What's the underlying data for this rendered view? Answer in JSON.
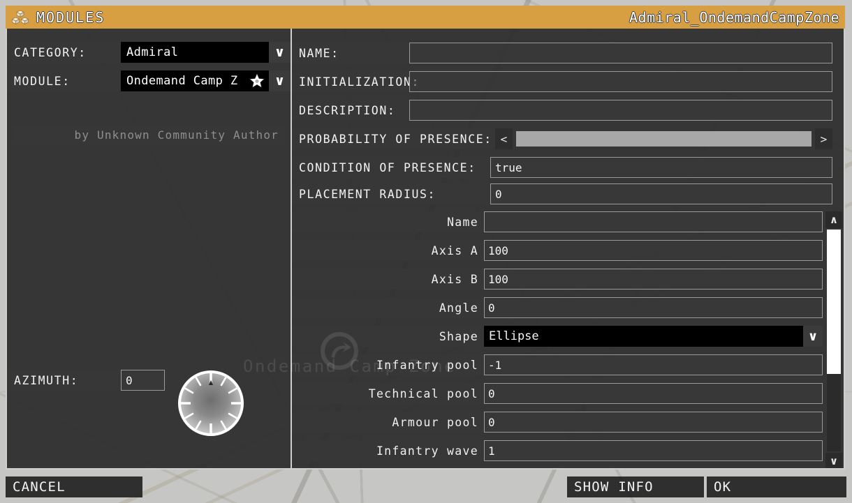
{
  "titlebar": {
    "icon": "modules-cubes-icon",
    "title": "MODULES",
    "module_id": "Admiral_OndemandCampZone"
  },
  "left_panel": {
    "category": {
      "label": "CATEGORY:",
      "value": "Admiral",
      "caret": "∨"
    },
    "module": {
      "label": "MODULE:",
      "value": "Ondemand Camp Z",
      "caret": "∨",
      "badge_icon": "star-icon"
    },
    "author": "by Unknown Community Author",
    "azimuth": {
      "label": "AZIMUTH:",
      "value": "0",
      "dial_icon": "azimuth-dial-icon"
    }
  },
  "watermark": {
    "logo_icon": "ondemand-camp-zone-logo-icon",
    "text": "Ondemand Camp Zone"
  },
  "right_panel": {
    "fields": [
      {
        "label": "NAME:",
        "value": ""
      },
      {
        "label": "INITIALIZATION:",
        "value": ""
      },
      {
        "label": "DESCRIPTION:",
        "value": ""
      }
    ],
    "probability": {
      "label": "PROBABILITY OF PRESENCE:",
      "prev": "<",
      "next": ">",
      "fill_percent": 100
    },
    "condition": {
      "label": "CONDITION OF PRESENCE:",
      "value": "true"
    },
    "placement": {
      "label": "PLACEMENT RADIUS:",
      "value": "0"
    },
    "properties": [
      {
        "label": "Name",
        "value": "",
        "type": "text"
      },
      {
        "label": "Axis A",
        "value": "100",
        "type": "text"
      },
      {
        "label": "Axis B",
        "value": "100",
        "type": "text"
      },
      {
        "label": "Angle",
        "value": "0",
        "type": "text"
      },
      {
        "label": "Shape",
        "value": "Ellipse",
        "type": "select",
        "caret": "∨"
      },
      {
        "label": "Infantry pool",
        "value": "-1",
        "type": "text"
      },
      {
        "label": "Technical pool",
        "value": "0",
        "type": "text"
      },
      {
        "label": "Armour pool",
        "value": "0",
        "type": "text"
      },
      {
        "label": "Infantry wave",
        "value": "1",
        "type": "text"
      }
    ],
    "scrollbar": {
      "up": "∧",
      "down": "∨",
      "thumb_position_percent": 0,
      "thumb_size_percent": 65
    }
  },
  "bottom_bar": {
    "cancel": "CANCEL",
    "show_info": "SHOW INFO",
    "ok": "OK"
  },
  "colors": {
    "title_bar": "#d79f42",
    "panel_bg": "#2d2d2d",
    "label_chip": "#373737",
    "field_border": "#9a9a9a",
    "select_bg": "#000000",
    "map_bg": "#c6c6c4",
    "accent_text": "#ffffff"
  }
}
